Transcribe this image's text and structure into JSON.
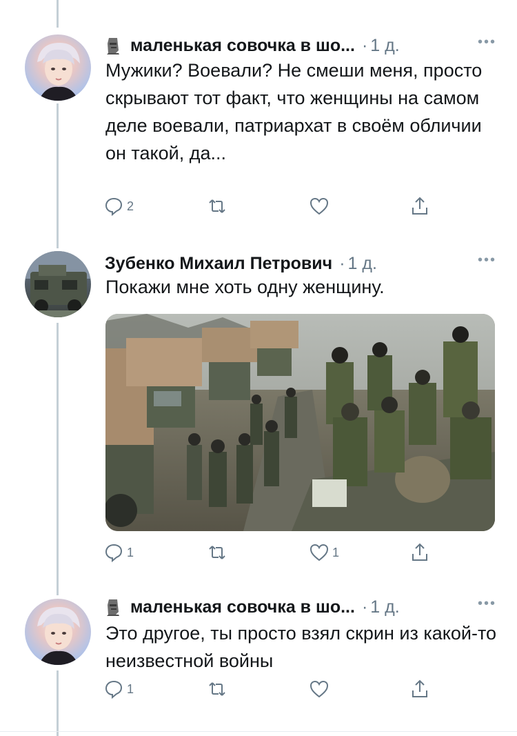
{
  "tweets": [
    {
      "author": "маленькая совочка в шо...",
      "time": "1 д.",
      "more": "•••",
      "text": "Мужики? Воевали? Не смеши меня, просто скрывают тот факт, что женщины на самом деле воевали, патриархат в своём обличии он такой, да...",
      "replies": "2",
      "retweets": "",
      "likes": "",
      "avatar": "anime-style portrait",
      "badge_icon": "moai-icon"
    },
    {
      "author": "Зубенко Михаил Петрович",
      "time": "1 д.",
      "more": "•••",
      "text": "Покажи мне хоть одну женщину.",
      "replies": "1",
      "retweets": "",
      "likes": "1",
      "avatar": "armored vehicle photo",
      "media": "photo of soldiers beside military trucks and an armored vehicle"
    },
    {
      "author": "маленькая совочка в шо...",
      "time": "1 д.",
      "more": "•••",
      "text": "Это другое, ты просто взял скрин из какой-то неизвестной войны",
      "replies": "1",
      "retweets": "",
      "likes": "",
      "avatar": "anime-style portrait",
      "badge_icon": "moai-icon"
    }
  ],
  "colors": {
    "text": "#14171a",
    "secondary": "#657786",
    "thread_line": "#c4cfd6"
  }
}
